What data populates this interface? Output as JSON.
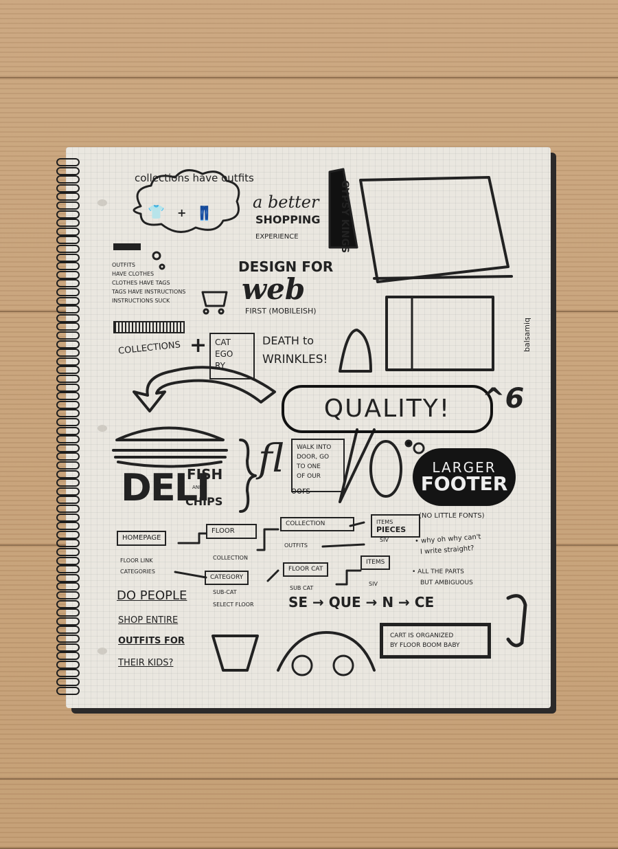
{
  "notebook": {
    "top_left": {
      "collections_have_outfits": "collections have outfits",
      "notes": [
        "OUTFITS",
        "HAVE CLOTHES",
        "CLOTHES HAVE TAGS",
        "TAGS HAVE INSTRUCTIONS",
        "INSTRUCTIONS SUCK"
      ]
    },
    "better_shopping": [
      "a better",
      "SHOPPING",
      "EXPERIENCE"
    ],
    "gypsy_kings": "GYPSY KINGS",
    "design_for_web": [
      "DESIGN FOR",
      "web",
      "FIRST (MOBILEISH)"
    ],
    "balsamiq": "balsamiq",
    "collections_category": {
      "collections": "COLLECTIONS",
      "plus": "+",
      "category": [
        "CAT",
        "EGO",
        "RY"
      ]
    },
    "death_to_wrinkles": [
      "DEATH to",
      "WRINKLES!"
    ],
    "quality": "QUALITY!",
    "caret_six": "^6",
    "deli": {
      "deli": "DELI",
      "fish": "FISH",
      "and": "AND",
      "chips": "CHIPS"
    },
    "walk_into": [
      "WALK INTO",
      "DOOR, GO",
      "TO ONE",
      "OF OUR"
    ],
    "floors": [
      "fl",
      "oors"
    ],
    "larger_footer": [
      "LARGER",
      "FOOTER"
    ],
    "no_little_fonts": "(NO LITTLE FONTS)",
    "flow": {
      "homepage": "HOMEPAGE",
      "floor_link": "FLOOR LINK",
      "categories": "CATEGORIES",
      "floor": "FLOOR",
      "collection_label": "COLLECTION",
      "category": "CATEGORY",
      "sub_cat_select_floor": [
        "SUB-CAT",
        "SELECT FLOOR"
      ],
      "collection_box": "COLLECTION",
      "outfits": "OUTFITS",
      "floor_cat": "FLOOR CAT",
      "sub_cat": "SUB CAT",
      "items_pieces": [
        "ITEMS",
        "PIECES"
      ],
      "siv_1": "SIV",
      "items": "ITEMS",
      "siv_2": "SIV"
    },
    "side_notes": [
      "• why oh why can't",
      "I write straight?",
      "• ALL THE PARTS",
      "BUT AMBIGUOUS"
    ],
    "do_people": [
      "DO PEOPLE",
      "SHOP ENTIRE",
      "OUTFITS FOR",
      "THEIR KIDS?"
    ],
    "sequence": "SE → QUE → N → CE",
    "cart_note": [
      "CART IS ORGANIZED",
      "BY FLOOR BOOM BABY"
    ]
  },
  "colors": {
    "ink": "#222222",
    "paper": "#eae7e0",
    "wood": "#c9a57e",
    "cover": "#2c2a2a"
  },
  "icons": [
    "shirt-icon",
    "shopping-cart-icon",
    "iron-icon",
    "sandwich-icon",
    "flip-flop-icon",
    "bucket-icon",
    "fish-icon"
  ]
}
